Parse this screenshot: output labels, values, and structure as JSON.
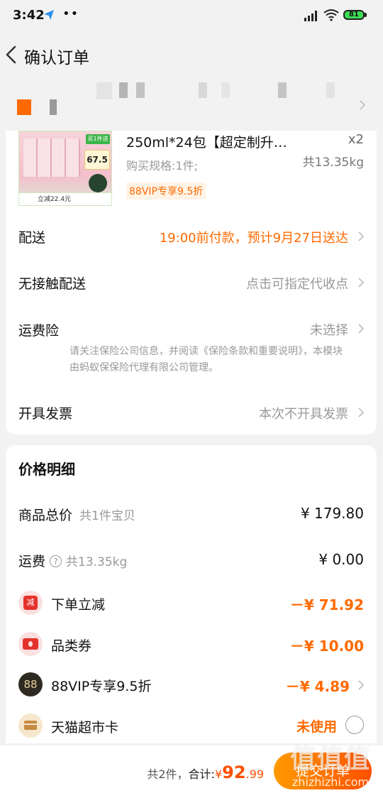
{
  "status_bar": {
    "time": "3:42",
    "dots": "••",
    "battery": "81"
  },
  "nav": {
    "title": "确认订单"
  },
  "product": {
    "name": "250ml*24包【超定制升…",
    "quantity": "x2",
    "spec": "购买规格:1件;",
    "weight": "共13.35kg",
    "vip_tag": "88VIP专享9.5折",
    "thumb_banner": "买1件送",
    "thumb_price": "67.5",
    "thumb_discount": "立减22.4元"
  },
  "options": {
    "delivery": {
      "label": "配送",
      "value": "19:00前付款，预计9月27日送达"
    },
    "contactless": {
      "label": "无接触配送",
      "value": "点击可指定代收点"
    },
    "shipping_insurance": {
      "label": "运费险",
      "value": "未选择",
      "note": "请关注保险公司信息，并阅读《保险条款和重要说明》，本模块由蚂蚁保保险代理有限公司管理。"
    },
    "invoice": {
      "label": "开具发票",
      "value": "本次不开具发票"
    }
  },
  "price_detail": {
    "title": "价格明细",
    "goods_total": {
      "label": "商品总价",
      "sub": "共1件宝贝",
      "value": "¥ 179.80"
    },
    "freight": {
      "label": "运费",
      "sub": "共13.35kg",
      "value": "¥ 0.00"
    },
    "order_discount": {
      "label": "下单立减",
      "badge": "减",
      "value": "－¥ 71.92"
    },
    "category_coupon": {
      "label": "品类券",
      "value": "－¥ 10.00"
    },
    "vip_discount": {
      "label": "88VIP专享9.5折",
      "badge": "88",
      "value": "－¥ 4.89"
    },
    "market_card": {
      "label": "天猫超市卡",
      "value": "未使用"
    }
  },
  "bottom_bar": {
    "count": "共2件，",
    "total_label": "合计:",
    "currency": "¥",
    "total_integer": "92",
    "total_decimal": ".99",
    "submit_label": "提交订单"
  },
  "watermark": {
    "brand": "值值值",
    "site": "zhizhizhi.com"
  },
  "colors": {
    "accent_orange": "#ff6a00",
    "submit_gradient_start": "#ff9b00",
    "submit_gradient_end": "#ff5000",
    "page_bg": "#f2f2f2"
  }
}
